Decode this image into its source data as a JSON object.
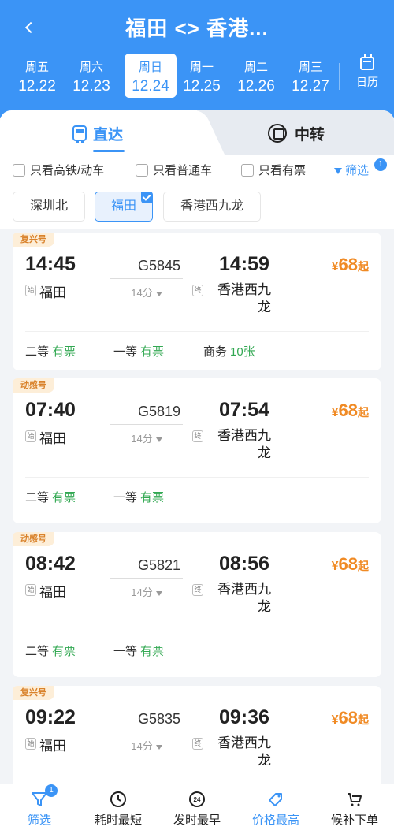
{
  "header": {
    "title": "福田 <> 香港...",
    "calendar_label": "日历",
    "colors": {
      "primary": "#3b94f6",
      "price": "#f08a24",
      "available": "#32a852"
    }
  },
  "dates": [
    {
      "weekday": "周五",
      "date": "12.22"
    },
    {
      "weekday": "周六",
      "date": "12.23"
    },
    {
      "weekday": "周日",
      "date": "12.24",
      "selected": true
    },
    {
      "weekday": "周一",
      "date": "12.25"
    },
    {
      "weekday": "周二",
      "date": "12.26"
    },
    {
      "weekday": "周三",
      "date": "12.27"
    }
  ],
  "tabs": {
    "direct": "直达",
    "transfer": "中转"
  },
  "filters": {
    "high_speed": "只看高铁/动车",
    "normal": "只看普通车",
    "available": "只看有票",
    "filter_label": "筛选",
    "filter_badge": "1"
  },
  "stations": [
    {
      "name": "深圳北",
      "selected": false
    },
    {
      "name": "福田",
      "selected": true
    },
    {
      "name": "香港西九龙",
      "selected": false
    }
  ],
  "trains": [
    {
      "type": "复兴号",
      "dep_time": "14:45",
      "arr_time": "14:59",
      "train_no": "G5845",
      "duration": "14分",
      "dep_mark": "始",
      "arr_mark": "终",
      "dep_station": "福田",
      "arr_station": "香港西九龙",
      "price_symbol": "¥",
      "price": "68",
      "price_suffix": "起",
      "seats": [
        {
          "class": "二等",
          "status": "有票"
        },
        {
          "class": "一等",
          "status": "有票"
        },
        {
          "class": "商务",
          "status": "10张"
        }
      ]
    },
    {
      "type": "动感号",
      "dep_time": "07:40",
      "arr_time": "07:54",
      "train_no": "G5819",
      "duration": "14分",
      "dep_mark": "始",
      "arr_mark": "终",
      "dep_station": "福田",
      "arr_station": "香港西九龙",
      "price_symbol": "¥",
      "price": "68",
      "price_suffix": "起",
      "seats": [
        {
          "class": "二等",
          "status": "有票"
        },
        {
          "class": "一等",
          "status": "有票"
        }
      ]
    },
    {
      "type": "动感号",
      "dep_time": "08:42",
      "arr_time": "08:56",
      "train_no": "G5821",
      "duration": "14分",
      "dep_mark": "始",
      "arr_mark": "终",
      "dep_station": "福田",
      "arr_station": "香港西九龙",
      "price_symbol": "¥",
      "price": "68",
      "price_suffix": "起",
      "seats": [
        {
          "class": "二等",
          "status": "有票"
        },
        {
          "class": "一等",
          "status": "有票"
        }
      ]
    },
    {
      "type": "复兴号",
      "dep_time": "09:22",
      "arr_time": "09:36",
      "train_no": "G5835",
      "duration": "14分",
      "dep_mark": "始",
      "arr_mark": "终",
      "dep_station": "福田",
      "arr_station": "香港西九龙",
      "price_symbol": "¥",
      "price": "68",
      "price_suffix": "起",
      "seats": []
    }
  ],
  "bottom_bar": {
    "filter": "筛选",
    "filter_badge": "1",
    "shortest": "耗时最短",
    "earliest": "发时最早",
    "highest_price": "价格最高",
    "waitlist": "候补下单"
  }
}
